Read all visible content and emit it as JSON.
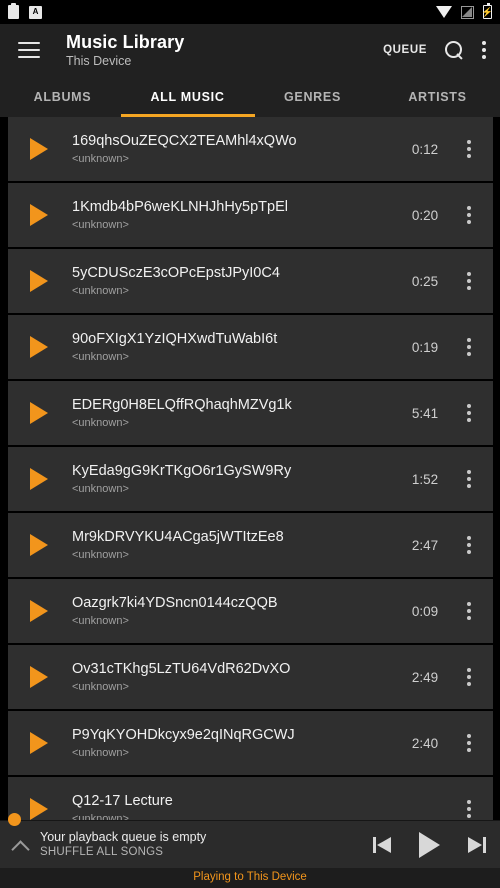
{
  "statusbar": {
    "left_icons": [
      "clipboard-icon",
      "app-badge-icon"
    ],
    "app_badge_letter": "A",
    "right_icons": [
      "wifi-icon",
      "signal-icon",
      "battery-charging-icon"
    ],
    "battery_glyph": "⚡"
  },
  "toolbar": {
    "menu_icon": "hamburger-icon",
    "title": "Music Library",
    "subtitle": "This Device",
    "queue_label": "QUEUE",
    "search_icon": "search-icon",
    "overflow_icon": "kebab-menu-icon"
  },
  "tabs": {
    "active_index": 1,
    "accent": "#f5a623",
    "items": [
      {
        "label": "ALBUMS"
      },
      {
        "label": "ALL MUSIC"
      },
      {
        "label": "GENRES"
      },
      {
        "label": "ARTISTS"
      }
    ]
  },
  "songs": [
    {
      "title": "169qhsOuZEQCX2TEAMhl4xQWo",
      "artist": "<unknown>",
      "duration": "0:12"
    },
    {
      "title": "1Kmdb4bP6weKLNHJhHy5pTpEl",
      "artist": "<unknown>",
      "duration": "0:20"
    },
    {
      "title": "5yCDUSczE3cOPcEpstJPyI0C4",
      "artist": "<unknown>",
      "duration": "0:25"
    },
    {
      "title": "90oFXIgX1YzIQHXwdTuWabI6t",
      "artist": "<unknown>",
      "duration": "0:19"
    },
    {
      "title": "EDERg0H8ELQffRQhaqhMZVg1k",
      "artist": "<unknown>",
      "duration": "5:41"
    },
    {
      "title": "KyEda9gG9KrTKgO6r1GySW9Ry",
      "artist": "<unknown>",
      "duration": "1:52"
    },
    {
      "title": "Mr9kDRVYKU4ACga5jWTItzEe8",
      "artist": "<unknown>",
      "duration": "2:47"
    },
    {
      "title": "Oazgrk7ki4YDSncn0144czQQB",
      "artist": "<unknown>",
      "duration": "0:09"
    },
    {
      "title": "Ov31cTKhg5LzTU64VdR62DvXO",
      "artist": "<unknown>",
      "duration": "2:49"
    },
    {
      "title": "P9YqKYOHDkcyx9e2qINqRGCWJ",
      "artist": "<unknown>",
      "duration": "2:40"
    },
    {
      "title": "Q12-17 Lecture",
      "artist": "<unknown>",
      "duration": ""
    }
  ],
  "player": {
    "expand_icon": "chevron-up-icon",
    "queue_status": "Your playback queue is empty",
    "shuffle_label": "SHUFFLE ALL SONGS",
    "prev_icon": "skip-previous-icon",
    "play_icon": "play-icon",
    "next_icon": "skip-next-icon"
  },
  "device_strip": {
    "text": "Playing to This Device",
    "color": "#f2951c"
  }
}
